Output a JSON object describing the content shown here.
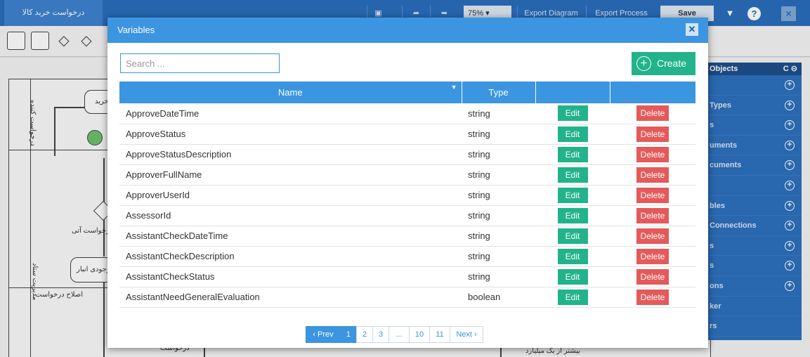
{
  "app": {
    "title": "درخواست خرید کالا",
    "toolbar": {
      "zoom": "75%",
      "export_diagram": "Export Diagram",
      "export_process": "Export Process",
      "save": "Save",
      "help": "?",
      "close": "×"
    },
    "diagram_texts": {
      "lane1": "درخواست کننده",
      "task1": "خرید",
      "gateway_label": "درخواست آتی",
      "lane2": "مدیریت ستاد",
      "task2": "موجودی انبار",
      "correction": "اصلاح درخواست",
      "bottom1": "درخواست",
      "bottom2": "بیشتر از یک میلیارد"
    },
    "side_panel": {
      "header": "Objects",
      "items": [
        {
          "label": "",
          "has_add": true
        },
        {
          "label": "Types",
          "has_add": true
        },
        {
          "label": "s",
          "has_add": true
        },
        {
          "label": "uments",
          "has_add": true
        },
        {
          "label": "cuments",
          "has_add": true
        },
        {
          "label": "",
          "has_add": true
        },
        {
          "label": "bles",
          "has_add": true
        },
        {
          "label": "Connections",
          "has_add": true
        },
        {
          "label": "s",
          "has_add": true
        },
        {
          "label": "s",
          "has_add": true
        },
        {
          "label": "ons",
          "has_add": true
        },
        {
          "label": "ker",
          "has_add": false
        },
        {
          "label": "rs",
          "has_add": false
        }
      ]
    }
  },
  "modal": {
    "title": "Variables",
    "search_placeholder": "Search ...",
    "create_label": "Create",
    "columns": {
      "name": "Name",
      "type": "Type",
      "edit": "",
      "delete": ""
    },
    "edit_label": "Edit",
    "delete_label": "Delete",
    "rows": [
      {
        "name": "ApproveDateTime",
        "type": "string"
      },
      {
        "name": "ApproveStatus",
        "type": "string"
      },
      {
        "name": "ApproveStatusDescription",
        "type": "string"
      },
      {
        "name": "ApproverFullName",
        "type": "string"
      },
      {
        "name": "ApproverUserId",
        "type": "string"
      },
      {
        "name": "AssessorId",
        "type": "string"
      },
      {
        "name": "AssistantCheckDateTime",
        "type": "string"
      },
      {
        "name": "AssistantCheckDescription",
        "type": "string"
      },
      {
        "name": "AssistantCheckStatus",
        "type": "string"
      },
      {
        "name": "AssistantNeedGeneralEvaluation",
        "type": "boolean"
      }
    ],
    "pagination": {
      "prev": "‹ Prev",
      "pages": [
        "1",
        "2",
        "3",
        "...",
        "10",
        "11"
      ],
      "active": "1",
      "next": "Next ›"
    }
  },
  "colors": {
    "header_blue": "#3b95e0",
    "create_green": "#22b38a",
    "delete_red": "#e45a5a",
    "topbar_blue": "#2a6ebd"
  }
}
